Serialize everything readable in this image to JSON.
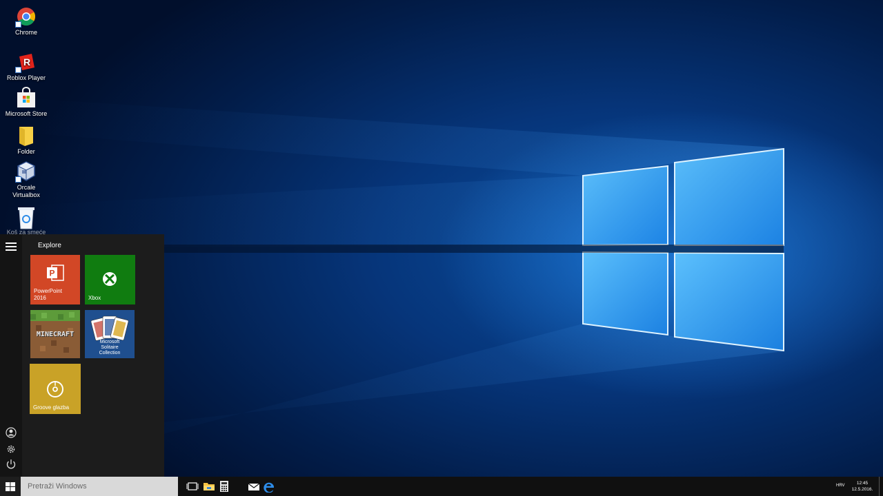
{
  "desktop": {
    "icons": [
      {
        "label": "Chrome",
        "icon": "chrome-icon"
      },
      {
        "label": "Roblox Player",
        "icon": "roblox-icon"
      },
      {
        "label": "Microsoft Store",
        "icon": "store-icon"
      },
      {
        "label": "Folder",
        "icon": "folder-icon"
      },
      {
        "label": "Orcale Virtualbox",
        "icon": "virtualbox-icon"
      },
      {
        "label": "Koš za smeće",
        "icon": "recycle-bin-icon"
      }
    ]
  },
  "start_menu": {
    "title": "Explore",
    "tiles": [
      {
        "label": "PowerPoint 2016",
        "color": "#d24726",
        "icon": "powerpoint-icon"
      },
      {
        "label": "Xbox",
        "color": "#107c10",
        "icon": "xbox-icon"
      },
      {
        "label": "",
        "color": "#7a5230",
        "icon": "minecraft-icon",
        "logo_text": "MINECRAFT"
      },
      {
        "label": "Microsoft Solitaire Collection",
        "color": "#1f4f8f",
        "icon": "solitaire-icon"
      },
      {
        "label": "Groove glazba",
        "color": "#c9a227",
        "icon": "groove-icon"
      }
    ],
    "rail": [
      "user-icon",
      "settings-icon",
      "power-icon"
    ]
  },
  "taskbar": {
    "search_placeholder": "Pretraži Windows",
    "pinned": [
      "task-view-icon",
      "file-explorer-icon",
      "calculator-icon",
      "mail-icon",
      "edge-icon"
    ],
    "language": "HRV",
    "time": "12:45",
    "date": "12.5.2016."
  },
  "colors": {
    "taskbar": "#101010",
    "start_menu": "#1c1c1c",
    "search_box": "#d9d9d9"
  }
}
